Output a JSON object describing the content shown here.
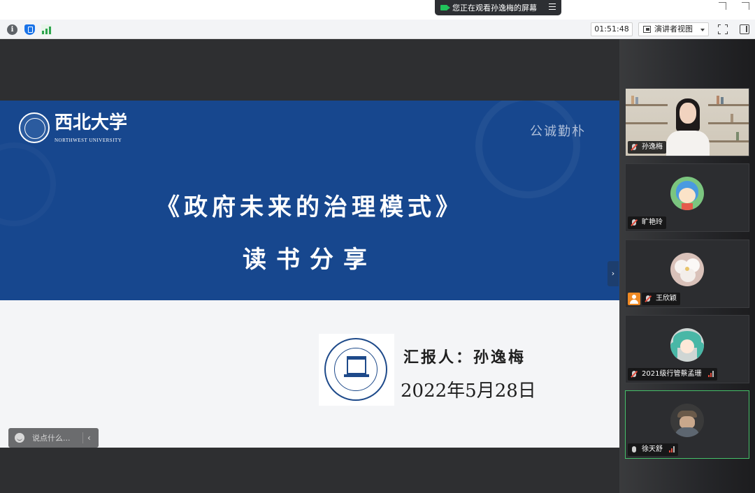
{
  "banner": {
    "text": "您正在观看孙逸梅的屏幕"
  },
  "toolbar": {
    "timer": "01:51:48",
    "view_mode": "演讲者视图"
  },
  "slide": {
    "university_name": "西北大学",
    "university_en": "NORTHWEST UNIVERSITY",
    "motto": "公诚勤朴",
    "title": "《政府未来的治理模式》",
    "subtitle": "读书分享",
    "reporter": "汇报人：孙逸梅",
    "date": "2022年5月28日"
  },
  "chat": {
    "placeholder": "说点什么..."
  },
  "participants": [
    {
      "name": "孙逸梅",
      "type": "video",
      "muted": true
    },
    {
      "name": "旷艳玲",
      "type": "avatar",
      "muted": true
    },
    {
      "name": "王欣颖",
      "type": "avatar",
      "muted": true
    },
    {
      "name": "2021级行管蔡孟珊",
      "type": "avatar",
      "muted": true
    },
    {
      "name": "徐天舒",
      "type": "avatar",
      "muted": false,
      "active": true
    }
  ],
  "colors": {
    "slide_band": "#17478e",
    "active_speaker": "#46c06a",
    "signal_green": "#2da44e"
  },
  "icons": {
    "info": "info-icon",
    "security": "shield-icon",
    "network": "signal-icon",
    "fullscreen": "fullscreen-icon",
    "side_panel": "panel-icon"
  }
}
